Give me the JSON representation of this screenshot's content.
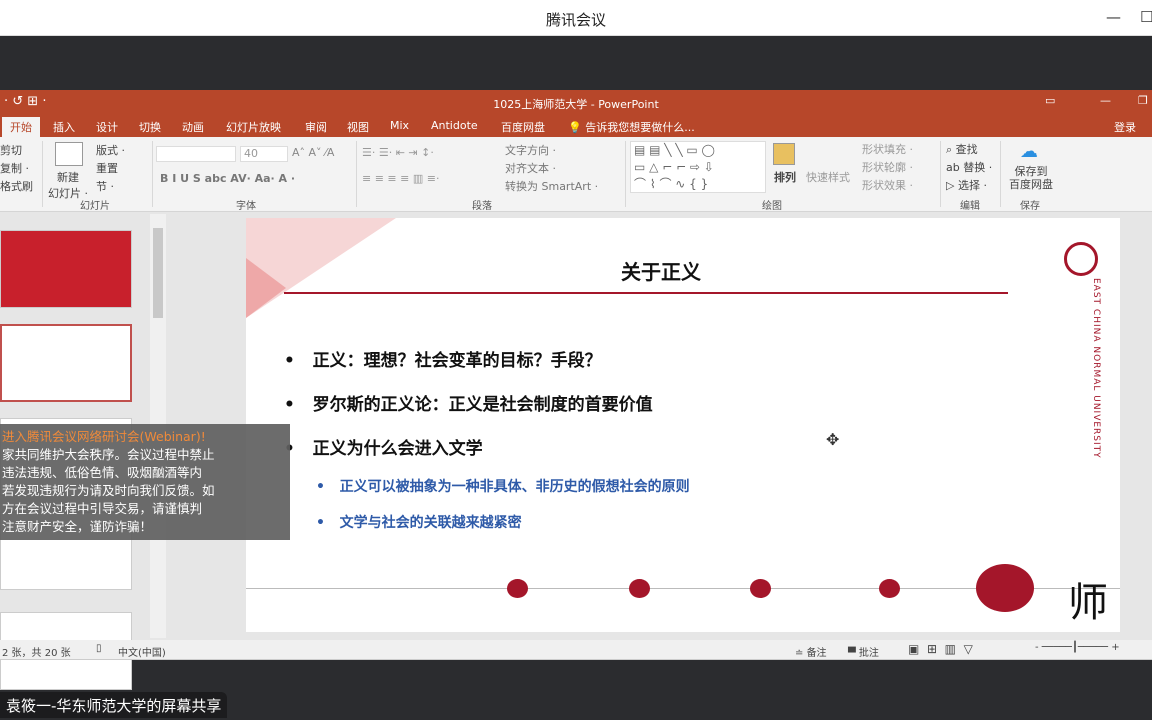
{
  "app_title": "腾讯会议",
  "ppt": {
    "title": "1025上海师范大学 - PowerPoint",
    "tabs": [
      "开始",
      "插入",
      "设计",
      "切换",
      "动画",
      "幻灯片放映",
      "审阅",
      "视图",
      "Mix",
      "Antidote",
      "百度网盘"
    ],
    "tell_me": "告诉我您想要做什么...",
    "login": "登录"
  },
  "ribbon": {
    "clipboard": [
      "剪切",
      "复制 ·",
      "格式刷"
    ],
    "new_slide": "新建\n幻灯片 ·",
    "layout": "版式 ·",
    "reset": "重置",
    "section": "节 ·",
    "slides_group": "幻灯片",
    "font_size": "40",
    "font_group": "字体",
    "font_btns": "B  I  U  S  abc  AV·  Aa·   A ·",
    "text_dir": "文字方向 ·",
    "align_text": "对齐文本 ·",
    "smartart": "转换为 SmartArt ·",
    "para_group": "段落",
    "arrange": "排列",
    "quick_style": "快速样式",
    "shape_fill": "形状填充 ·",
    "shape_outline": "形状轮廓 ·",
    "shape_effect": "形状效果 ·",
    "draw_group": "绘图",
    "find": "查找",
    "replace": "替换 ·",
    "select": "选择 ·",
    "edit_group": "编辑",
    "save_baidu": "保存到\n百度网盘",
    "save_group": "保存"
  },
  "slide": {
    "title": "关于正义",
    "bullets": [
      "正义：理想？社会变革的目标？手段？",
      "罗尔斯的正义论：正义是社会制度的首要价值",
      "正义为什么会进入文学"
    ],
    "sub_bullets": [
      "正义可以被抽象为一种非具体、非历史的假想社会的原则",
      "文学与社会的关联越来越紧密"
    ],
    "logo_text": "EAST CHINA NORMAL UNIVERSITY",
    "corner_char": "师",
    "accent": "#a4162a"
  },
  "notice": {
    "line1": "进入腾讯会议网络研讨会(Webinar)!",
    "lines": [
      "家共同维护大会秩序。会议过程中禁止",
      "违法违规、低俗色情、吸烟酗酒等内",
      "若发现违规行为请及时向我们反馈。如",
      "方在会议过程中引导交易，请谨慎判",
      "注意财产安全，谨防诈骗！"
    ]
  },
  "status": {
    "slide_count": "2 张，共 20 张",
    "language": "中文(中国)",
    "notes": "备注",
    "comments": "批注"
  },
  "share_label": "袁筱一-华东师范大学的屏幕共享"
}
